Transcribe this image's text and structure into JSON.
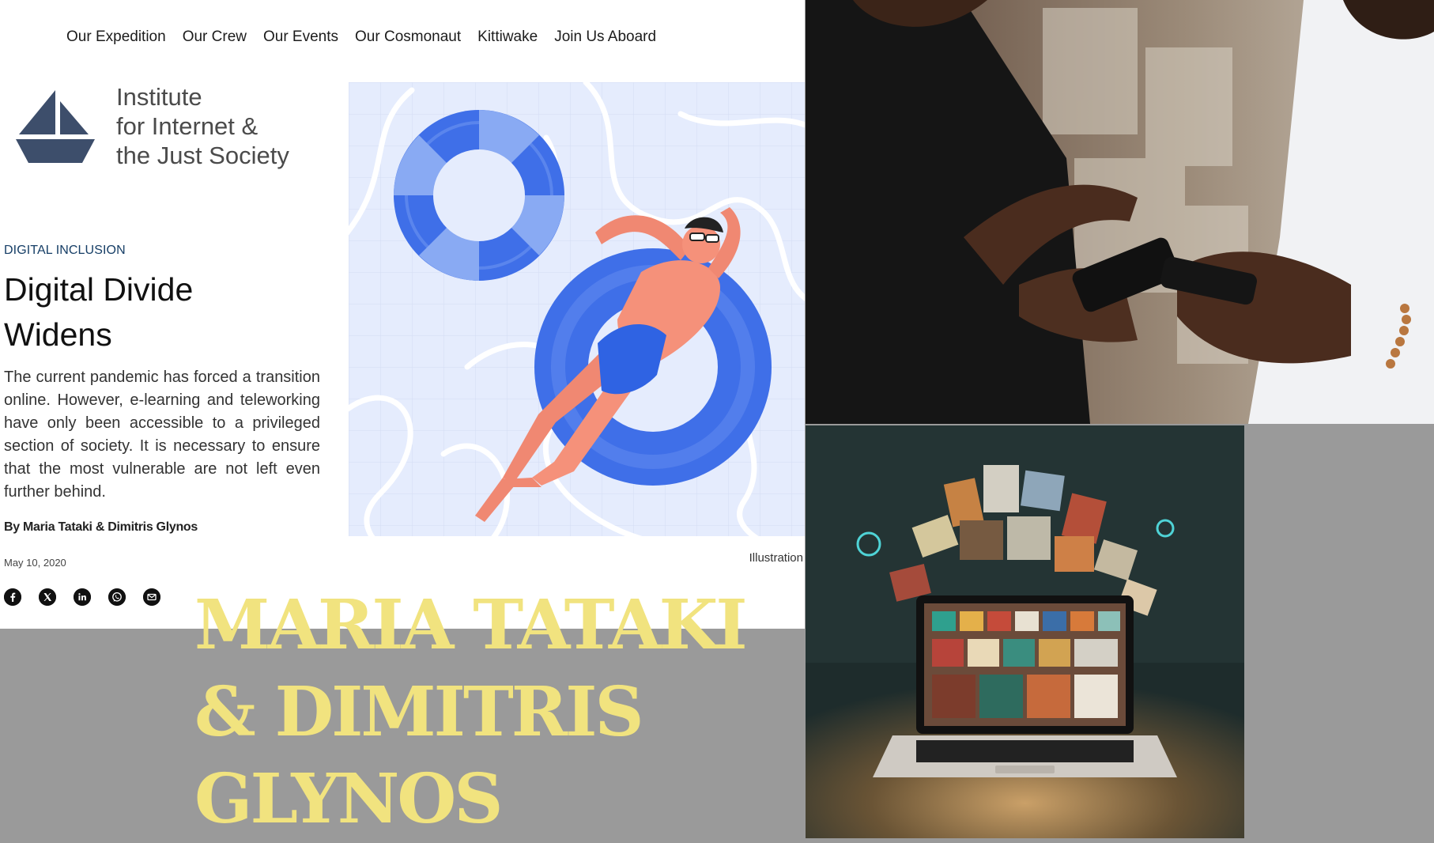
{
  "nav": {
    "items": [
      "Our Expedition",
      "Our Crew",
      "Our Events",
      "Our Cosmonaut",
      "Kittiwake",
      "Join Us Aboard"
    ]
  },
  "logo": {
    "line1": "Institute",
    "line2": "for Internet &",
    "line3": "the Just Society",
    "icon": "sailboat-icon"
  },
  "article": {
    "category": "DIGITAL INCLUSION",
    "title_line1": "Digital Divide",
    "title_line2": "Widens",
    "summary": "The current pandemic has forced a transition online. However, e-learning and teleworking have only been accessible to a privileged section of society. It is necessary to ensure that the most vulnerable are not left even further behind.",
    "byline": "By Maria Tataki & Dimitris Glynos",
    "date": "May 10, 2020",
    "caption": "Illustration",
    "share": [
      "facebook-icon",
      "x-icon",
      "linkedin-icon",
      "whatsapp-icon",
      "email-icon"
    ]
  },
  "overlay": {
    "line1": "MARIA TATAKI",
    "line2": "& DIMITRIS",
    "line3": "GLYNOS"
  },
  "colors": {
    "overlay_text": "#f1e37f",
    "category": "#163e66",
    "background_gray": "#9a9a9a",
    "illustration_blue": "#3f6fe8"
  }
}
